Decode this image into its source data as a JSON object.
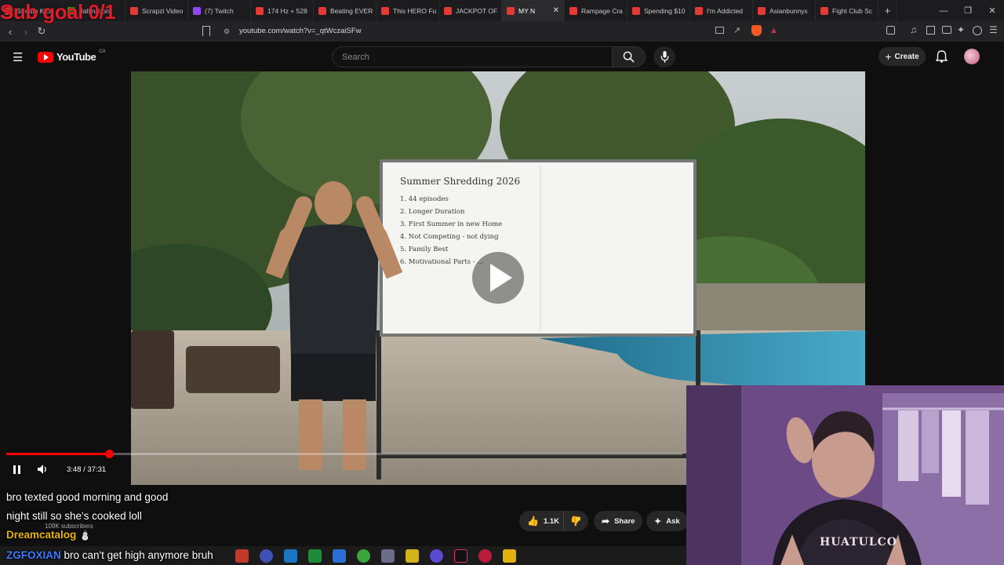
{
  "browser": {
    "tabs": [
      {
        "label": "Stream Kick",
        "color": "#e53935"
      },
      {
        "label": "dallmation",
        "color": "#53a318"
      },
      {
        "label": "Scrapzi Video",
        "color": "#e53935"
      },
      {
        "label": "(7) Twitch",
        "color": "#9146ff"
      },
      {
        "label": "174 Hz + 528",
        "color": "#e53935"
      },
      {
        "label": "Beating EVER",
        "color": "#e53935"
      },
      {
        "label": "This HERO Fu",
        "color": "#e53935"
      },
      {
        "label": "JACKPOT OF",
        "color": "#e53935"
      },
      {
        "label": "MY N",
        "color": "#e53935",
        "active": true
      },
      {
        "label": "Rampage Cra",
        "color": "#e53935"
      },
      {
        "label": "Spending $10",
        "color": "#e53935"
      },
      {
        "label": "I'm Addicted",
        "color": "#e53935"
      },
      {
        "label": "Asianbunnyx",
        "color": "#e53935"
      },
      {
        "label": "Fight Club Sc",
        "color": "#e53935"
      }
    ],
    "new_tab": "+",
    "url": "youtube.com/watch?v=_qtWczaiSFw"
  },
  "youtube": {
    "logo_text": "YouTube",
    "region": "CA",
    "search_placeholder": "Search",
    "create_label": "Create"
  },
  "player": {
    "overlay_text": "Sub goal 0/1",
    "current_time": "3:48",
    "duration": "37:31",
    "time_display": "3:48 / 37:31",
    "progress": 0.1013,
    "whiteboard": {
      "title": "Summer Shredding 2026",
      "items": [
        "1. 44 episodes",
        "2. Longer Duration",
        "3. First Summer in new Home",
        "4. Not Competing - not dying",
        "5. Family Best",
        "6. Motivational Parts - ..."
      ]
    }
  },
  "actions": {
    "likes": "1.1K",
    "share": "Share",
    "ask": "Ask"
  },
  "channel": {
    "subscribers": "109K subscribers"
  },
  "chat": {
    "line1": "bro texted good morning and good",
    "line2": "night still so she's cooked loll",
    "user1": "Dreamcatalog",
    "user2": "ZGFOXIAN",
    "line3": "bro can't get high anymore bruh"
  }
}
